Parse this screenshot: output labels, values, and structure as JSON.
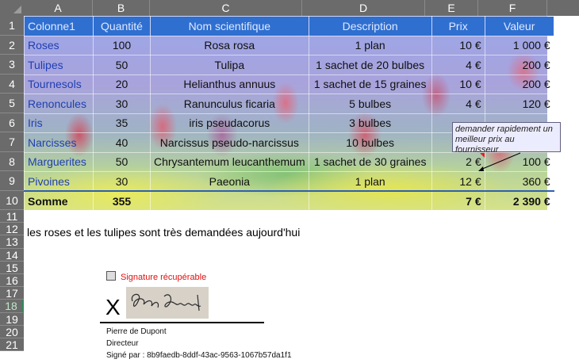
{
  "columns": [
    "A",
    "B",
    "C",
    "D",
    "E",
    "F"
  ],
  "rows": [
    "1",
    "2",
    "3",
    "4",
    "5",
    "6",
    "7",
    "8",
    "9",
    "10",
    "11",
    "12",
    "13",
    "14",
    "15",
    "16",
    "17",
    "18",
    "19",
    "20",
    "21"
  ],
  "table": {
    "headers": [
      "Colonne1",
      "Quantité",
      "Nom scientifique",
      "Description",
      "Prix",
      "Valeur"
    ],
    "rows": [
      [
        "Roses",
        "100",
        "Rosa rosa",
        "1 plan",
        "10 €",
        "1 000 €"
      ],
      [
        "Tulipes",
        "50",
        "Tulipa",
        "1 sachet de 20 bulbes",
        "4 €",
        "200 €"
      ],
      [
        "Tournesols",
        "20",
        "Helianthus annuus",
        "1 sachet de 15 graines",
        "10 €",
        "200 €"
      ],
      [
        "Renoncules",
        "30",
        "Ranunculus ficaria",
        "5 bulbes",
        "4 €",
        "120 €"
      ],
      [
        "Iris",
        "35",
        "iris pseudacorus",
        "3 bulbes",
        "",
        ""
      ],
      [
        "Narcisses",
        "40",
        "Narcissus pseudo-narcissus",
        "10 bulbes",
        "",
        ""
      ],
      [
        "Marguerites",
        "50",
        "Chrysantemum leucanthemum",
        "1 sachet de 30 graines",
        "2 €",
        "100 €"
      ],
      [
        "Pivoines",
        "30",
        "Paeonia",
        "1 plan",
        "12 €",
        "360 €"
      ]
    ],
    "total": [
      "Somme",
      "355",
      "",
      "",
      "7 €",
      "2 390 €"
    ]
  },
  "comment": "demander rapidement un meilleur prix au fournisseur",
  "note": "les roses et les tulipes sont très demandées aujourd'hui",
  "signature": {
    "flag": "Signature récupérable",
    "x_mark": "X",
    "name": "Pierre de Dupont",
    "title": "Directeur",
    "signed_by": "Signé par : 8b9faedb-8ddf-43ac-9563-1067b57da1f1",
    "handwriting": "Pierre Dupont"
  },
  "colors": {
    "header_bg": "#6b6b6b",
    "table_header": "#2f6fd0",
    "selected_row": "#2e8b57",
    "flag_red": "#e01010"
  }
}
